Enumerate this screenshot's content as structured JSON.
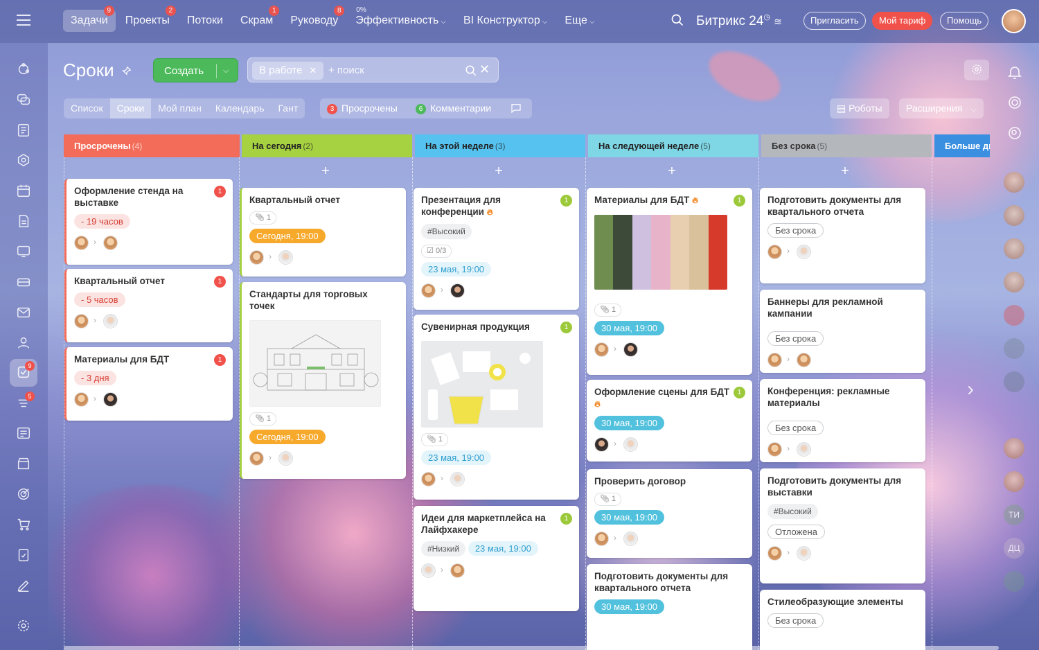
{
  "topbar": {
    "nav": [
      {
        "label": "Задачи",
        "badge": "9",
        "active": true
      },
      {
        "label": "Проекты",
        "badge": "2"
      },
      {
        "label": "Потоки"
      },
      {
        "label": "Скрам",
        "badge": "1"
      },
      {
        "label": "Руководу",
        "badge": "8"
      },
      {
        "label": "Эффективность",
        "pct": "0%",
        "chevron": true
      },
      {
        "label": "BI Конструктор",
        "chevron": true
      },
      {
        "label": "Еще",
        "chevron": true
      }
    ],
    "brand": "Битрикс 24",
    "invite": "Пригласить",
    "tariff": "Мой тариф",
    "help": "Помощь"
  },
  "sidebar": {
    "tasks_badge": "9",
    "flows_badge": "5"
  },
  "page": {
    "title": "Сроки",
    "create_label": "Создать",
    "filter_tag": "В работе",
    "search_placeholder": "+ поиск",
    "views": [
      "Список",
      "Сроки",
      "Мой план",
      "Календарь",
      "Гант"
    ],
    "counters": {
      "overdue_count": "3",
      "overdue_label": "Просрочены",
      "comments_count": "6",
      "comments_label": "Комментарии"
    },
    "robots": "Роботы",
    "extensions": "Расширения"
  },
  "columns": [
    {
      "title": "Просрочены",
      "count": "(4)",
      "color": "#f36c5a"
    },
    {
      "title": "На сегодня",
      "count": "(2)",
      "color": "#a6d141"
    },
    {
      "title": "На этой неделе",
      "count": "(3)",
      "color": "#55c2ef"
    },
    {
      "title": "На следующей неделе",
      "count": "(5)",
      "color": "#7fd6e5"
    },
    {
      "title": "Без срока",
      "count": "(5)",
      "color": "#b4b7bc"
    },
    {
      "title": "Больше дв",
      "count": "",
      "color": "#3b8fe0"
    }
  ],
  "add_symbol": "+",
  "cards": {
    "c1": {
      "title": "Оформление стенда на выставке",
      "badge": "1",
      "deadline": "- 19 часов"
    },
    "c2": {
      "title": "Квартальный отчет",
      "badge": "1",
      "deadline": "- 5 часов"
    },
    "c3": {
      "title": "Материалы для БДТ",
      "badge": "1",
      "deadline": "- 3 дня"
    },
    "c4": {
      "title": "Квартальный отчет",
      "files": "1",
      "deadline": "Сегодня, 19:00"
    },
    "c5": {
      "title": "Стандарты для торговых точек",
      "files": "1",
      "deadline": "Сегодня, 19:00"
    },
    "c6": {
      "title": "Презентация для конференции",
      "badge": "1",
      "tag": "#Высокий",
      "checklist": "0/3",
      "deadline": "23 мая, 19:00"
    },
    "c7": {
      "title": "Сувенирная продукция",
      "badge": "1",
      "files": "1",
      "deadline": "23 мая, 19:00"
    },
    "c8": {
      "title": "Идеи для маркетплейса на Лайфхакере",
      "badge": "1",
      "tag": "#Низкий",
      "deadline": "23 мая, 19:00"
    },
    "c9": {
      "title": "Материалы для БДТ",
      "badge": "1",
      "files": "1",
      "deadline": "30 мая, 19:00"
    },
    "c10": {
      "title": "Оформление сцены для БДТ",
      "badge": "1",
      "deadline": "30 мая, 19:00"
    },
    "c11": {
      "title": "Проверить договор",
      "files": "1",
      "deadline": "30 мая, 19:00"
    },
    "c12": {
      "title": "Подготовить документы для квартального отчета",
      "deadline": "30 мая, 19:00"
    },
    "c13": {
      "title": "Подготовить документы для квартального отчета",
      "deadline": "Без срока"
    },
    "c14": {
      "title": "Баннеры для рекламной кампании",
      "deadline": "Без срока"
    },
    "c15": {
      "title": "Конференция: рекламные материалы",
      "deadline": "Без срока"
    },
    "c16": {
      "title": "Подготовить документы для выставки",
      "tag": "#Высокий",
      "deadline": "Отложена"
    },
    "c17": {
      "title": "Стилеобразующие элементы",
      "deadline": "Без срока"
    }
  },
  "right_sidebar": {
    "initials1": "ТИ",
    "initials2": "ДЦ"
  }
}
